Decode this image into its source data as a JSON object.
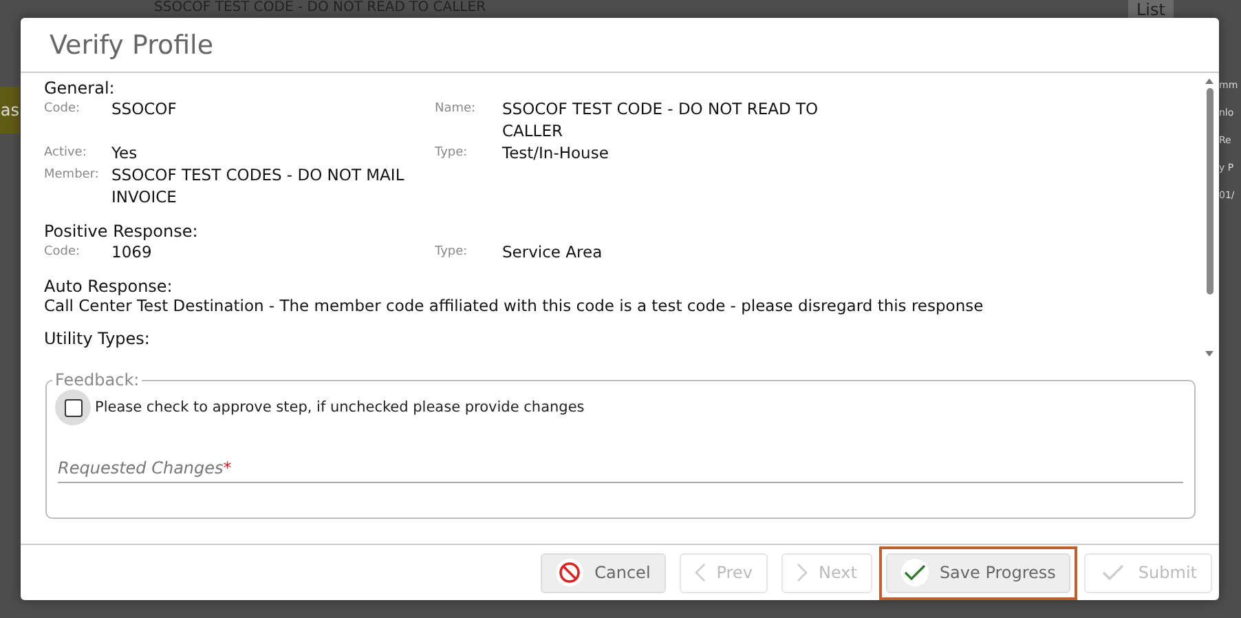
{
  "background": {
    "title": "SSOCOF TEST CODE - DO NOT READ TO CALLER",
    "left_tab": "as",
    "list_button": "List",
    "right_fragments": [
      "mm",
      "nlo",
      "Re",
      "y P",
      "01/"
    ]
  },
  "dialog": {
    "title": "Verify Profile",
    "sections": [
      {
        "title": "General:",
        "kind": "fields",
        "rows": [
          {
            "left": {
              "label": "Code:",
              "value": "SSOCOF"
            },
            "right": {
              "label": "Name:",
              "value": "SSOCOF TEST CODE - DO NOT READ TO CALLER"
            }
          },
          {
            "left": {
              "label": "Active:",
              "value": "Yes"
            },
            "right": {
              "label": "Type:",
              "value": "Test/In-House"
            }
          },
          {
            "left": {
              "label": "Member:",
              "value": "SSOCOF TEST CODES - DO NOT MAIL INVOICE"
            }
          }
        ]
      },
      {
        "title": "Positive Response:",
        "kind": "fields",
        "rows": [
          {
            "left": {
              "label": "Code:",
              "value": "1069"
            },
            "right": {
              "label": "Type:",
              "value": "Service Area"
            }
          }
        ]
      },
      {
        "title": "Auto Response:",
        "kind": "text",
        "text": "Call Center Test Destination - The member code affiliated with this code is a test code - please disregard this response"
      },
      {
        "title": "Utility Types:",
        "kind": "text"
      }
    ],
    "feedback": {
      "legend": "Feedback:",
      "checkbox": {
        "label": "Please check to approve step, if unchecked please provide changes",
        "checked": false
      },
      "field": {
        "placeholder": "Requested Changes",
        "required_mark": "*"
      }
    },
    "buttons": [
      {
        "label": "Cancel",
        "kind": "cancel",
        "disabled": false,
        "highlighted": false
      },
      {
        "label": "Prev",
        "kind": "prev",
        "disabled": true,
        "highlighted": false
      },
      {
        "label": "Next",
        "kind": "next",
        "disabled": true,
        "highlighted": false
      },
      {
        "label": "Save Progress",
        "kind": "save",
        "disabled": false,
        "highlighted": true
      },
      {
        "label": "Submit",
        "kind": "submit",
        "disabled": true,
        "highlighted": false
      }
    ]
  }
}
